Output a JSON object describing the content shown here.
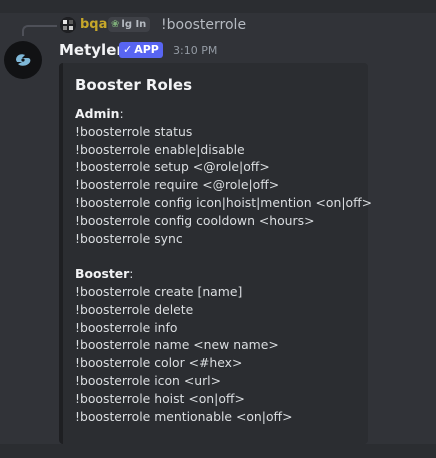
{
  "reply": {
    "username": "bqa",
    "tag_label": "lg In",
    "text": "!boosterrole"
  },
  "message": {
    "username": "Metylen",
    "badge": "APP",
    "timestamp": "3:10 PM"
  },
  "embed": {
    "title": "Booster Roles",
    "admin_heading": "Admin",
    "admin_colon": ":",
    "admin_commands": [
      "!boosterrole status",
      "!boosterrole enable|disable",
      "!boosterrole setup <@role|off>",
      "!boosterrole require <@role|off>",
      "!boosterrole config icon|hoist|mention <on|off>",
      "!boosterrole config cooldown <hours>",
      "!boosterrole sync"
    ],
    "booster_heading": "Booster",
    "booster_colon": ":",
    "booster_commands": [
      "!boosterrole create [name]",
      "!boosterrole delete",
      "!boosterrole info",
      "!boosterrole name <new name>",
      "!boosterrole color <#hex>",
      "!boosterrole icon <url>",
      "!boosterrole hoist <on|off>",
      "!boosterrole mentionable <on|off>"
    ]
  },
  "icons": {
    "reply_avatar": "pixel-avatar-icon",
    "bot_avatar": "bot-logo-icon",
    "verified": "checkmark-icon",
    "tag": "leaf-icon"
  },
  "colors": {
    "background": "#313338",
    "embed": "#2b2d31",
    "app_badge": "#5865f2",
    "reply_username": "#c7a72a"
  }
}
